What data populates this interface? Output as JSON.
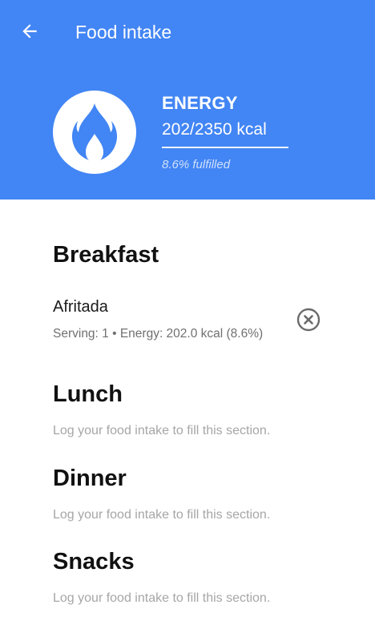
{
  "app_bar": {
    "title": "Food intake",
    "back_icon": "arrow-back-icon",
    "color": "#4285f4"
  },
  "energy": {
    "icon": "flame-icon",
    "label": "ENERGY",
    "value": "202/2350 kcal",
    "fulfilled": "8.6% fulfilled",
    "fulfilled_fraction": 0.086
  },
  "sections": {
    "breakfast": {
      "title": "Breakfast",
      "items": [
        {
          "name": "Afritada",
          "detail": "Serving: 1 • Energy: 202.0 kcal (8.6%)",
          "remove_icon": "remove-circle-icon"
        }
      ]
    },
    "lunch": {
      "title": "Lunch",
      "empty_text": "Log your food intake to fill this section."
    },
    "dinner": {
      "title": "Dinner",
      "empty_text": "Log your food intake to fill this section."
    },
    "snacks": {
      "title": "Snacks",
      "empty_text": "Log your food intake to fill this section."
    }
  }
}
